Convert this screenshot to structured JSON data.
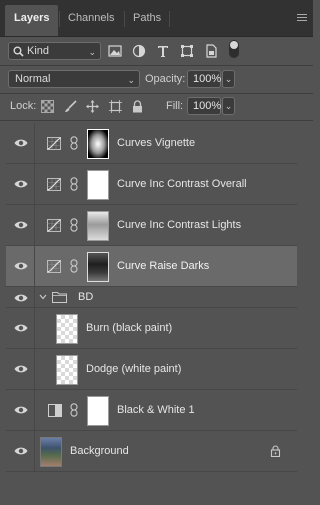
{
  "tabs": [
    {
      "label": "Layers",
      "active": true
    },
    {
      "label": "Channels",
      "active": false
    },
    {
      "label": "Paths",
      "active": false
    }
  ],
  "filter": {
    "kind_label": "Kind",
    "icons": [
      "pixel-filter-icon",
      "adjustment-filter-icon",
      "type-filter-icon",
      "shape-filter-icon",
      "smart-object-filter-icon"
    ]
  },
  "blend": {
    "mode": "Normal",
    "opacity_label": "Opacity:",
    "opacity_value": "100%",
    "lock_label": "Lock:",
    "fill_label": "Fill:",
    "fill_value": "100%"
  },
  "layers": [
    {
      "name": "Curves Vignette",
      "type": "curves",
      "thumb": "vignette",
      "selected": false
    },
    {
      "name": "Curve Inc Contrast Overall",
      "type": "curves",
      "thumb": "white",
      "selected": false
    },
    {
      "name": "Curve Inc Contrast Lights",
      "type": "curves",
      "thumb": "photo-light",
      "selected": false
    },
    {
      "name": "Curve Raise Darks",
      "type": "curves",
      "thumb": "photo-dark",
      "selected": true
    },
    {
      "name": "BD",
      "type": "group"
    },
    {
      "name": "Burn (black paint)",
      "type": "pixel",
      "thumb": "checker"
    },
    {
      "name": "Dodge (white paint)",
      "type": "pixel",
      "thumb": "checker"
    },
    {
      "name": "Black & White 1",
      "type": "black-white",
      "thumb": "white"
    },
    {
      "name": "Background",
      "type": "background",
      "thumb": "bg-photo",
      "locked": true
    }
  ],
  "colors": {
    "panel_bg": "#535353",
    "tabbar_bg": "#323232",
    "selected_row": "#6a6a6a",
    "field_bg": "#3b3b3b"
  }
}
